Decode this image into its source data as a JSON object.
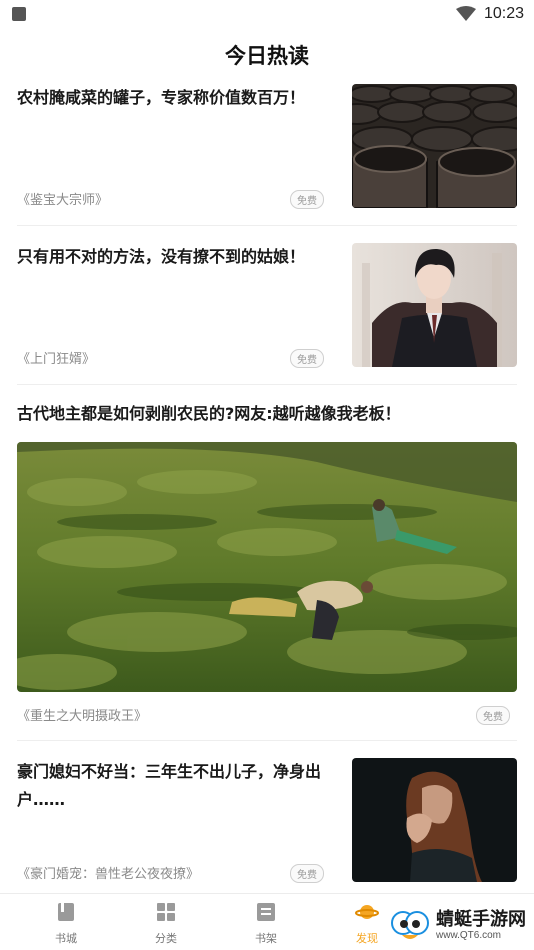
{
  "status": {
    "time": "10:23"
  },
  "page": {
    "title": "今日热读"
  },
  "articles": [
    {
      "title": "农村腌咸菜的罐子，专家称价值数百万！",
      "source": "《鉴宝大宗师》",
      "badge": "免费"
    },
    {
      "title": "只有用不对的方法，没有撩不到的姑娘！",
      "source": "《上门狂婿》",
      "badge": "免费"
    },
    {
      "title": "古代地主都是如何剥削农民的?网友:越听越像我老板！",
      "source": "《重生之大明摄政王》",
      "badge": "免费"
    },
    {
      "title": "豪门媳妇不好当：三年生不出儿子，净身出户……",
      "source": "《豪门婚宠：兽性老公夜夜撩》",
      "badge": "免费"
    }
  ],
  "tabs": [
    {
      "label": "书城",
      "icon": "book-icon"
    },
    {
      "label": "分类",
      "icon": "grid-icon"
    },
    {
      "label": "书架",
      "icon": "bookshelf-icon"
    },
    {
      "label": "发现",
      "icon": "planet-icon",
      "active": true
    }
  ],
  "watermark": {
    "name": "蜻蜓手游网",
    "url": "www.QT6.com"
  },
  "colors": {
    "accent": "#f5a623"
  }
}
